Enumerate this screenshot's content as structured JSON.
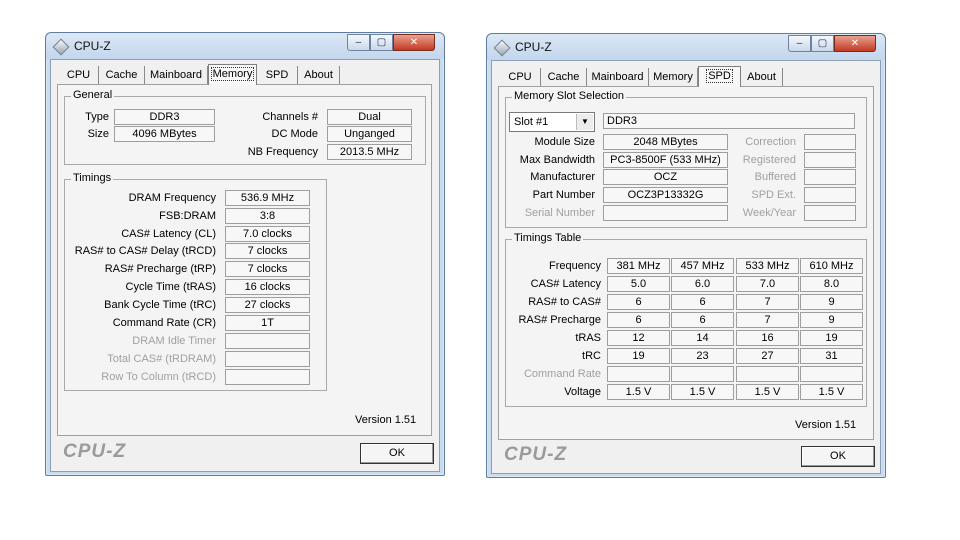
{
  "left": {
    "title": "CPU-Z",
    "controls": {
      "minimize": "–",
      "maximize": "▢",
      "close": "✕"
    },
    "tabs": [
      "CPU",
      "Cache",
      "Mainboard",
      "Memory",
      "SPD",
      "About"
    ],
    "active_tab": "Memory",
    "general": {
      "title": "General",
      "type_label": "Type",
      "type_value": "DDR3",
      "size_label": "Size",
      "size_value": "4096 MBytes",
      "channels_label": "Channels #",
      "channels_value": "Dual",
      "dcmode_label": "DC Mode",
      "dcmode_value": "Unganged",
      "nbfreq_label": "NB Frequency",
      "nbfreq_value": "2013.5 MHz"
    },
    "timings": {
      "title": "Timings",
      "rows": [
        {
          "label": "DRAM Frequency",
          "value": "536.9 MHz",
          "dim": false
        },
        {
          "label": "FSB:DRAM",
          "value": "3:8",
          "dim": false
        },
        {
          "label": "CAS# Latency (CL)",
          "value": "7.0 clocks",
          "dim": false
        },
        {
          "label": "RAS# to CAS# Delay (tRCD)",
          "value": "7 clocks",
          "dim": false
        },
        {
          "label": "RAS# Precharge (tRP)",
          "value": "7 clocks",
          "dim": false
        },
        {
          "label": "Cycle Time (tRAS)",
          "value": "16 clocks",
          "dim": false
        },
        {
          "label": "Bank Cycle Time (tRC)",
          "value": "27 clocks",
          "dim": false
        },
        {
          "label": "Command Rate (CR)",
          "value": "1T",
          "dim": false
        },
        {
          "label": "DRAM Idle Timer",
          "value": "",
          "dim": true
        },
        {
          "label": "Total CAS# (tRDRAM)",
          "value": "",
          "dim": true
        },
        {
          "label": "Row To Column (tRCD)",
          "value": "",
          "dim": true
        }
      ]
    },
    "version": "Version 1.51",
    "brand": "CPU-Z",
    "ok": "OK"
  },
  "right": {
    "title": "CPU-Z",
    "controls": {
      "minimize": "–",
      "maximize": "▢",
      "close": "✕"
    },
    "tabs": [
      "CPU",
      "Cache",
      "Mainboard",
      "Memory",
      "SPD",
      "About"
    ],
    "active_tab": "SPD",
    "slot": {
      "title": "Memory Slot Selection",
      "selected": "Slot #1",
      "type": "DDR3",
      "rows": [
        {
          "label": "Module Size",
          "value": "2048 MBytes",
          "dim": false,
          "r_label": "Correction",
          "r_value": ""
        },
        {
          "label": "Max Bandwidth",
          "value": "PC3-8500F (533 MHz)",
          "dim": false,
          "r_label": "Registered",
          "r_value": ""
        },
        {
          "label": "Manufacturer",
          "value": "OCZ",
          "dim": false,
          "r_label": "Buffered",
          "r_value": ""
        },
        {
          "label": "Part Number",
          "value": "OCZ3P13332G",
          "dim": false,
          "r_label": "SPD Ext.",
          "r_value": ""
        },
        {
          "label": "Serial Number",
          "value": "",
          "dim": true,
          "r_label": "Week/Year",
          "r_value": ""
        }
      ]
    },
    "timings_table": {
      "title": "Timings Table",
      "rows": [
        {
          "label": "Frequency",
          "dim": false,
          "cells": [
            "381 MHz",
            "457 MHz",
            "533 MHz",
            "610 MHz"
          ]
        },
        {
          "label": "CAS# Latency",
          "dim": false,
          "cells": [
            "5.0",
            "6.0",
            "7.0",
            "8.0"
          ]
        },
        {
          "label": "RAS# to CAS#",
          "dim": false,
          "cells": [
            "6",
            "6",
            "7",
            "9"
          ]
        },
        {
          "label": "RAS# Precharge",
          "dim": false,
          "cells": [
            "6",
            "6",
            "7",
            "9"
          ]
        },
        {
          "label": "tRAS",
          "dim": false,
          "cells": [
            "12",
            "14",
            "16",
            "19"
          ]
        },
        {
          "label": "tRC",
          "dim": false,
          "cells": [
            "19",
            "23",
            "27",
            "31"
          ]
        },
        {
          "label": "Command Rate",
          "dim": true,
          "cells": [
            "",
            "",
            "",
            ""
          ]
        },
        {
          "label": "Voltage",
          "dim": false,
          "cells": [
            "1.5 V",
            "1.5 V",
            "1.5 V",
            "1.5 V"
          ]
        }
      ]
    },
    "version": "Version 1.51",
    "brand": "CPU-Z",
    "ok": "OK"
  }
}
